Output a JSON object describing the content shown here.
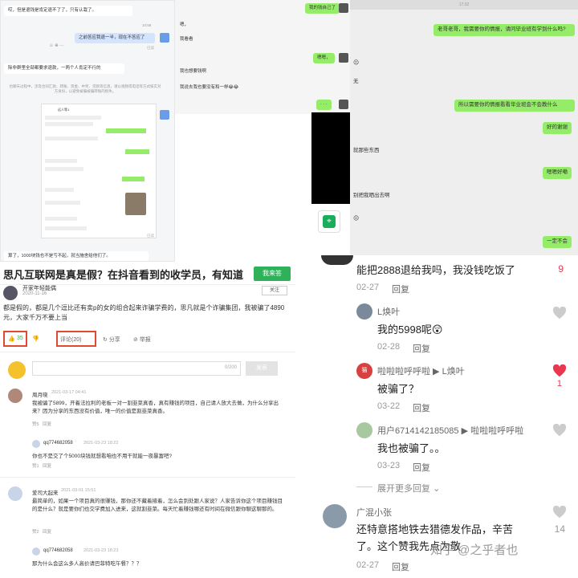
{
  "chat1": {
    "top_msg": "哎，但是退钱是肯定退不了了，只有认栽了。",
    "time1": "10:58",
    "blue_msg": "之前答应我退一半，现在不答应了",
    "read1": "已读",
    "long_msg": "除非群里全部都要求退款，一两个人肯定不行的",
    "notice": "也聊天过程中，涉及合同汇款、转账、资金、中奖、贷款等信息，请以视频或电话等方式核实对方身份，以避免被骗被骗转账的损失。",
    "inner_name": "远人等1",
    "bottom_msg": "算了，1000块钱也不是亏不起，就当施舍给他们了。",
    "read2": "已读"
  },
  "chat2": {
    "top_right": "我的钱自己了",
    "m1": "嗯，",
    "m2": "我看看",
    "green1": "嗯嗯，",
    "m3": "我也想要钱啊",
    "m4": "我说去我也要没有和一样😂😂"
  },
  "chat3": {
    "time": "17:32",
    "g1": "老哥老哥，我需要你的情报，请问毕业班有学到什么吗?",
    "w1": "无",
    "g2": "所以需要你的情报看看毕业班会不会教什么",
    "g3": "好的谢谢",
    "g4": "嗯嗯好嘞",
    "w2": "就那些东西",
    "w3": "别把我晒出去啊",
    "g5": "一定不会"
  },
  "article": {
    "title": "思凡互联网是真是假？在抖音看到的收学员，有知道...",
    "ask_button": "我来答",
    "author": "开家年轻能偶",
    "follow": "关注",
    "date": "2020-11-16",
    "body": "都是假的，都是几个逗比还有卖p的女的组合起来诈骗学费的，思凡就是个诈骗集团，我被骗了4890元，大家千万不要上当",
    "likes": "35",
    "comment_count": "评论(20)",
    "share": "分享",
    "report": "举报",
    "counter": "0/200",
    "send": "发表",
    "comments": [
      {
        "name": "周月晓",
        "date": "2021-03-17 04:41",
        "text": "我被骗了5899，开着法拉利的老板一对一割韭菜真香，真有赚钱的项目，自己请人放大去做，为什么分享出来？因为分享的东西没有价值，唯一的价值是割韭菜真香。",
        "likes": "赞5",
        "reply": "回复"
      },
      {
        "name": "qq774682058",
        "date": "2021-03-23 18:22",
        "text": "你也不是交了个5000块钱就想看咱也不用干就能一夜暴富吧?",
        "likes": "赞1",
        "reply": "回复"
      },
      {
        "name": "爱司大起来",
        "date": "2021-03-01 15:51",
        "text": "最简单的，如果一个项目真的很赚钱，那你还不藏着掖着，怎么会到处跟人家说？人家告诉你这个项目赚钱目的是什么？就是要你们也交学费加入进来，这就割韭菜。每天忙着赚钱哪还有时间在微信跟你聊这聊那的。",
        "likes": "赞2",
        "reply": "回复"
      },
      {
        "name": "qq774682058",
        "date": "2021-03-23 18:23",
        "text": "那为什么会这么多人高价请巴菲特吃午餐？？？",
        "likes": "",
        "reply": ""
      }
    ]
  },
  "douyin": {
    "c0_text": "能把2888退给我吗，我没钱吃饭了",
    "c0_date": "02-27",
    "c0_reply": "回复",
    "c0_likes": "9",
    "c1_name": "L焕叶",
    "c1_text": "我的5998呢😲",
    "c1_date": "02-28",
    "c1_reply": "回复",
    "c2_name": "啦啦啦呼呼啦 ▶ L焕叶",
    "c2_text": "被骗了？",
    "c2_date": "03-22",
    "c2_reply": "回复",
    "c2_likes": "1",
    "c3_name": "用户6714142185085 ▶ 啦啦啦呼呼啦",
    "c3_text": "我也被骗了。。",
    "c3_date": "03-23",
    "c3_reply": "回复",
    "expand": "展开更多回复",
    "c4_name": "广混小张",
    "c4_text": "还特意搭地铁去猎德发作品，辛苦了。这个赞我先点为敬",
    "c4_date": "02-27",
    "c4_reply": "回复",
    "c4_likes": "14",
    "watermark": "知乎 @之乎者也"
  }
}
